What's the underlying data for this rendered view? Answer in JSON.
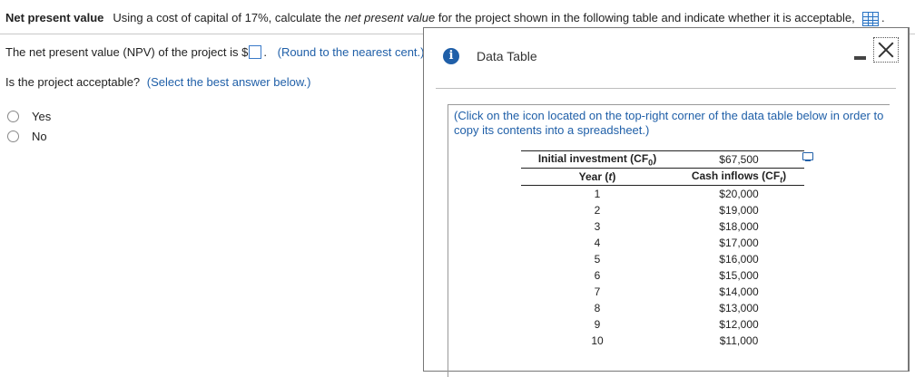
{
  "question": {
    "title": "Net present value",
    "text_before": "Using a cost of capital of 17%, calculate the ",
    "text_italic": "net present value",
    "text_after": " for the project shown in the following table and indicate whether it is acceptable,",
    "trailing": "."
  },
  "npv": {
    "prompt": "The net present value (NPV) of the project is $",
    "answer_value": "",
    "after_box": ".",
    "hint": "(Round to the nearest cent.)"
  },
  "acceptable": {
    "prompt": "Is the project acceptable?",
    "hint": "(Select the best answer below.)",
    "options": [
      "Yes",
      "No"
    ]
  },
  "popup": {
    "title": "Data Table",
    "instructions": "(Click on the icon located on the top-right corner of the data table below in order to copy its contents into a spreadsheet.)",
    "table": {
      "initial_label": "Initial investment (CF",
      "initial_sub": "0",
      "initial_close": ")",
      "initial_value": "$67,500",
      "year_label": "Year (",
      "year_var": "t",
      "year_close": ")",
      "cash_label": "Cash inflows (CF",
      "cash_sub": "t",
      "cash_close": ")",
      "rows": [
        {
          "year": "1",
          "cash": "$20,000"
        },
        {
          "year": "2",
          "cash": "$19,000"
        },
        {
          "year": "3",
          "cash": "$18,000"
        },
        {
          "year": "4",
          "cash": "$17,000"
        },
        {
          "year": "5",
          "cash": "$16,000"
        },
        {
          "year": "6",
          "cash": "$15,000"
        },
        {
          "year": "7",
          "cash": "$14,000"
        },
        {
          "year": "8",
          "cash": "$13,000"
        },
        {
          "year": "9",
          "cash": "$12,000"
        },
        {
          "year": "10",
          "cash": "$11,000"
        }
      ]
    }
  },
  "colors": {
    "accent": "#1f5fa8",
    "icon_blue": "#2a74c4"
  },
  "icons": [
    "table-grid-icon",
    "info-icon",
    "minimize-icon",
    "close-icon",
    "copy-icon",
    "radio-icon"
  ]
}
